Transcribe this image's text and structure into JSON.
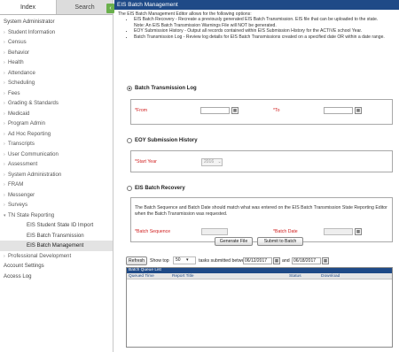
{
  "sidebar": {
    "tabs": {
      "index": "Index",
      "search": "Search"
    },
    "collapse_icon": "‹",
    "items": [
      {
        "label": "System Administrator",
        "kind": "top"
      },
      {
        "label": "Student Information",
        "kind": "sub"
      },
      {
        "label": "Census",
        "kind": "sub"
      },
      {
        "label": "Behavior",
        "kind": "sub"
      },
      {
        "label": "Health",
        "kind": "sub"
      },
      {
        "label": "Attendance",
        "kind": "sub"
      },
      {
        "label": "Scheduling",
        "kind": "sub"
      },
      {
        "label": "Fees",
        "kind": "sub"
      },
      {
        "label": "Grading & Standards",
        "kind": "sub"
      },
      {
        "label": "Medicaid",
        "kind": "sub"
      },
      {
        "label": "Program Admin",
        "kind": "sub"
      },
      {
        "label": "Ad Hoc Reporting",
        "kind": "sub"
      },
      {
        "label": "Transcripts",
        "kind": "sub"
      },
      {
        "label": "User Communication",
        "kind": "sub"
      },
      {
        "label": "Assessment",
        "kind": "sub"
      },
      {
        "label": "System Administration",
        "kind": "sub"
      },
      {
        "label": "FRAM",
        "kind": "sub"
      },
      {
        "label": "Messenger",
        "kind": "sub"
      },
      {
        "label": "Surveys",
        "kind": "sub"
      },
      {
        "label": "TN State Reporting",
        "kind": "open"
      },
      {
        "label": "EIS Student State ID Import",
        "kind": "child"
      },
      {
        "label": "EIS Batch Transmission",
        "kind": "child"
      },
      {
        "label": "EIS Batch Management",
        "kind": "child",
        "selected": true
      },
      {
        "label": "Professional Development",
        "kind": "sub"
      },
      {
        "label": "Account Settings",
        "kind": "top"
      },
      {
        "label": "Access Log",
        "kind": "top"
      }
    ]
  },
  "main": {
    "title": "EIS Batch Management",
    "intro": "The EIS Batch Management Editor allows for the following options:",
    "bullets": [
      "EIS Batch Recovery - Recreate a previously generated EIS Batch Transmission. EIS file that can be uploaded to the state.",
      "Note: An EIS Batch Transmission Warnings File will NOT be generated.",
      "EOY Submission History - Output all records contained within EIS Submission History for the ACTIVE school Year.",
      "Batch Transmission Log - Review log details for EIS Batch Transmissions created on a specified date OR within a date range."
    ],
    "options": {
      "log": "Batch Transmission Log",
      "eoy": "EOY Submission History",
      "recovery": "EIS Batch Recovery"
    },
    "from_label": "*From",
    "to_label": "*To",
    "start_year_label": "*Start Year",
    "start_year_value": "2016",
    "recovery_note": "The Batch Sequence and Batch Date should match what was entered on the EIS Batch Transmission State Reporting Editor when the Batch Transmission was requested.",
    "batch_sequence_label": "*Batch Sequence",
    "batch_date_label": "*Batch Date",
    "generate_button": "Generate File",
    "submit_button": "Submit to Batch"
  },
  "queue": {
    "refresh": "Refresh",
    "show_top": "Show top",
    "top_count": "50",
    "submitted_between": "tasks submitted between",
    "date_from": "06/12/2017",
    "and": "and",
    "date_to": "06/18/2017",
    "title": "Batch Queue List",
    "columns": [
      "Queued Time",
      "Report Title",
      "Status",
      "Download"
    ]
  },
  "colors": {
    "header": "#1f4a87",
    "accent": "#6ab04c",
    "required": "#d12020"
  },
  "icons": {
    "calendar": "calendar-icon",
    "dropdown": "chevron-down-icon"
  }
}
